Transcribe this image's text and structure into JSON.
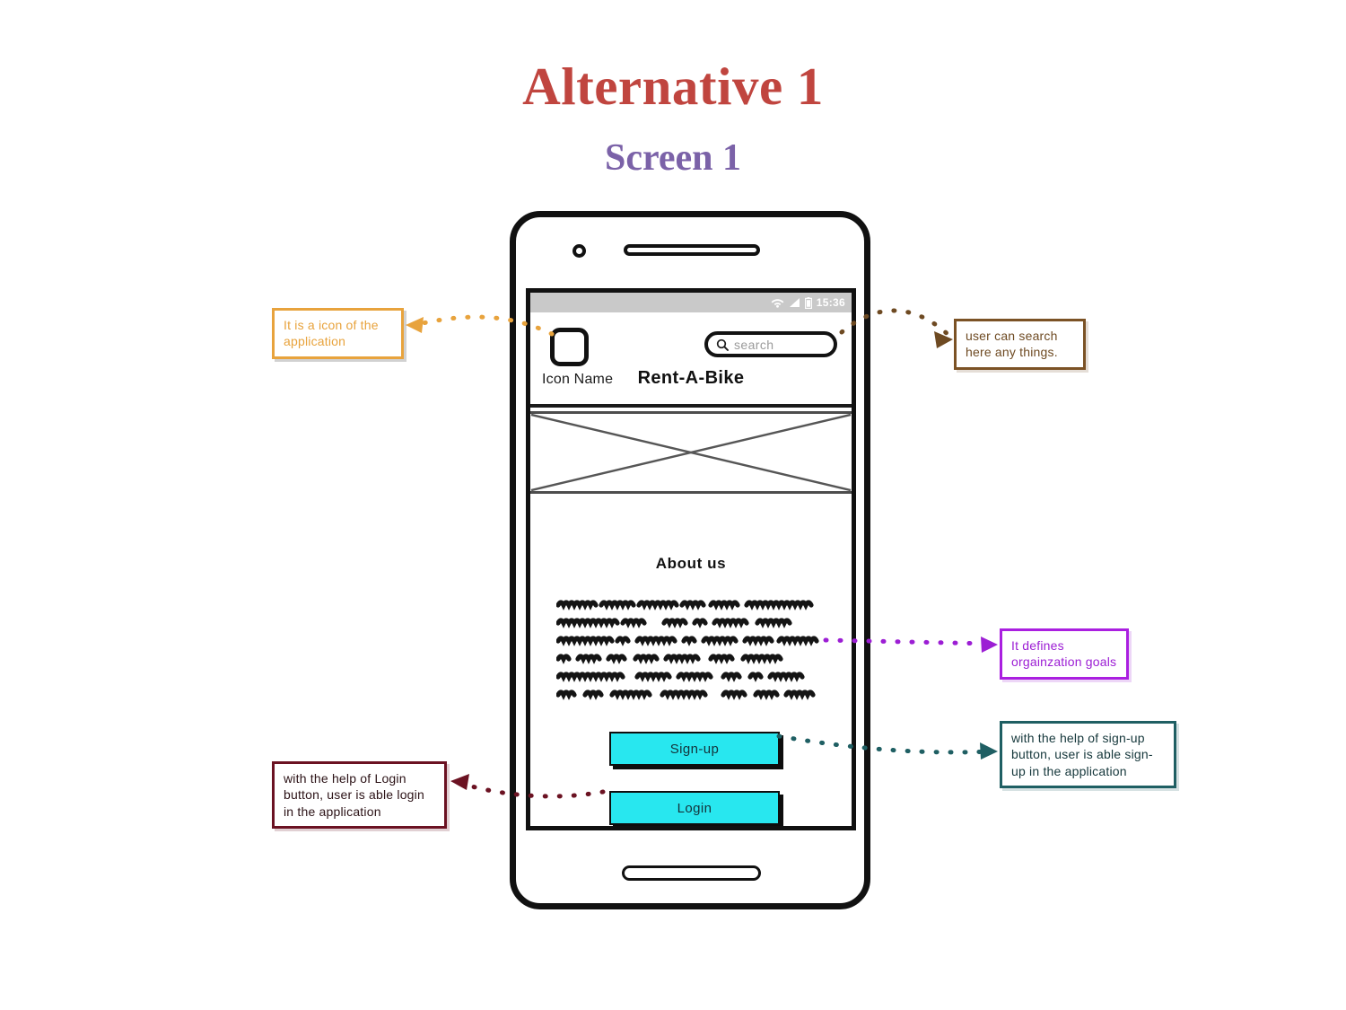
{
  "page": {
    "title": "Alternative 1",
    "subtitle": "Screen 1",
    "title_color": "#c0453f",
    "subtitle_color": "#7b62a8"
  },
  "phone": {
    "status_bar": {
      "time": "15:36",
      "icons": [
        "wifi-icon",
        "signal-icon",
        "battery-icon"
      ],
      "background": "#c9c9c9"
    },
    "header": {
      "app_icon_label": "Icon Name",
      "app_title": "Rent-A-Bike",
      "search": {
        "placeholder": "search",
        "icon": "search-icon"
      }
    },
    "hero": {
      "type": "image-placeholder-crossed-box"
    },
    "about": {
      "heading": "About us",
      "body_lines": 6,
      "body_style": "handwritten-scribble-placeholder"
    },
    "buttons": {
      "signup": "Sign-up",
      "login": "Login",
      "color": "#28e7ef"
    }
  },
  "annotations": [
    {
      "id": "icon-note",
      "text": "It is a icon of the application",
      "color": "#e8a33d",
      "points_to": "app-icon"
    },
    {
      "id": "search-note",
      "text": "user can search here any things.",
      "color": "#6e4a22",
      "points_to": "search-field"
    },
    {
      "id": "about-note",
      "text": "It defines orgainzation goals",
      "color": "#9c1ed4",
      "points_to": "about-text"
    },
    {
      "id": "signup-note",
      "text": "with the help of sign-up button, user is able sign-up in the application",
      "color": "#15373b",
      "points_to": "signup-button"
    },
    {
      "id": "login-note",
      "text": "with the help of Login button, user is able login in the application",
      "color": "#2b1216",
      "points_to": "login-button"
    }
  ]
}
